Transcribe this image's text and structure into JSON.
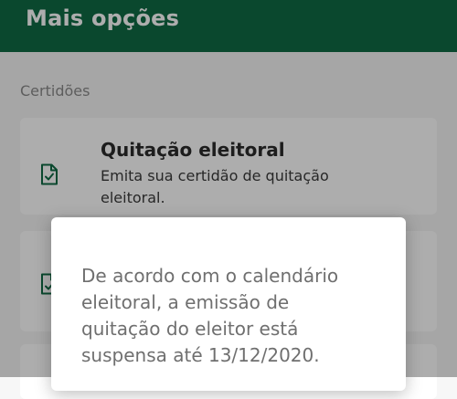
{
  "app_bar": {
    "title": "Mais opções",
    "color": "#0f6b45"
  },
  "section": {
    "title": "Certidões"
  },
  "cards": [
    {
      "icon": "document-check-icon",
      "title": "Quitação eleitoral",
      "description": "Emita sua certidão de quitação eleitoral."
    },
    {
      "icon": "document-check-icon"
    }
  ],
  "dialog": {
    "message": "De acordo com o calendário eleitoral, a emissão de quitação do eleitor está suspensa até 13/12/2020."
  }
}
